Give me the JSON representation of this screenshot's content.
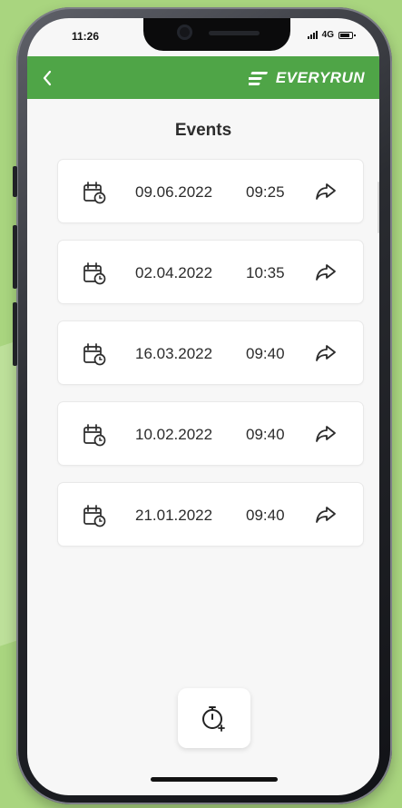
{
  "status_bar": {
    "time": "11:26",
    "network": "4G"
  },
  "app": {
    "brand_name": "EVERYRUN",
    "back_icon": "back-chevron-icon",
    "brand_icon": "everyrun-logo-icon",
    "colors": {
      "header": "#4fa547",
      "background": "#f7f7f7",
      "text": "#2c2c2c"
    }
  },
  "page": {
    "title": "Events"
  },
  "events": [
    {
      "date": "09.06.2022",
      "time": "09:25",
      "icon": "calendar-clock-icon",
      "action_icon": "share-icon"
    },
    {
      "date": "02.04.2022",
      "time": "10:35",
      "icon": "calendar-clock-icon",
      "action_icon": "share-icon"
    },
    {
      "date": "16.03.2022",
      "time": "09:40",
      "icon": "calendar-clock-icon",
      "action_icon": "share-icon"
    },
    {
      "date": "10.02.2022",
      "time": "09:40",
      "icon": "calendar-clock-icon",
      "action_icon": "share-icon"
    },
    {
      "date": "21.01.2022",
      "time": "09:40",
      "icon": "calendar-clock-icon",
      "action_icon": "share-icon"
    }
  ],
  "actions": {
    "stopwatch_icon": "stopwatch-plus-icon"
  }
}
